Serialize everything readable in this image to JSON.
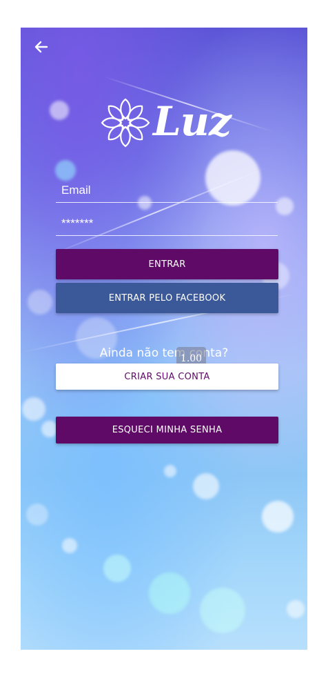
{
  "app": {
    "name": "Luz"
  },
  "login": {
    "email_placeholder": "Email",
    "password_value": "*******",
    "enter_label": "ENTRAR",
    "facebook_label": "ENTRAR PELO FACEBOOK",
    "no_account_text": "Ainda não tem conta?",
    "create_account_label": "CRIAR SUA CONTA",
    "forgot_password_label": "ESQUECI MINHA SENHA"
  },
  "overlay": {
    "zoom_level": "1.00"
  },
  "colors": {
    "primary": "#5e0a66",
    "facebook": "#3b5998",
    "white": "#ffffff"
  },
  "icons": {
    "back": "arrow-left-icon",
    "logo": "flower-mandala-icon"
  }
}
